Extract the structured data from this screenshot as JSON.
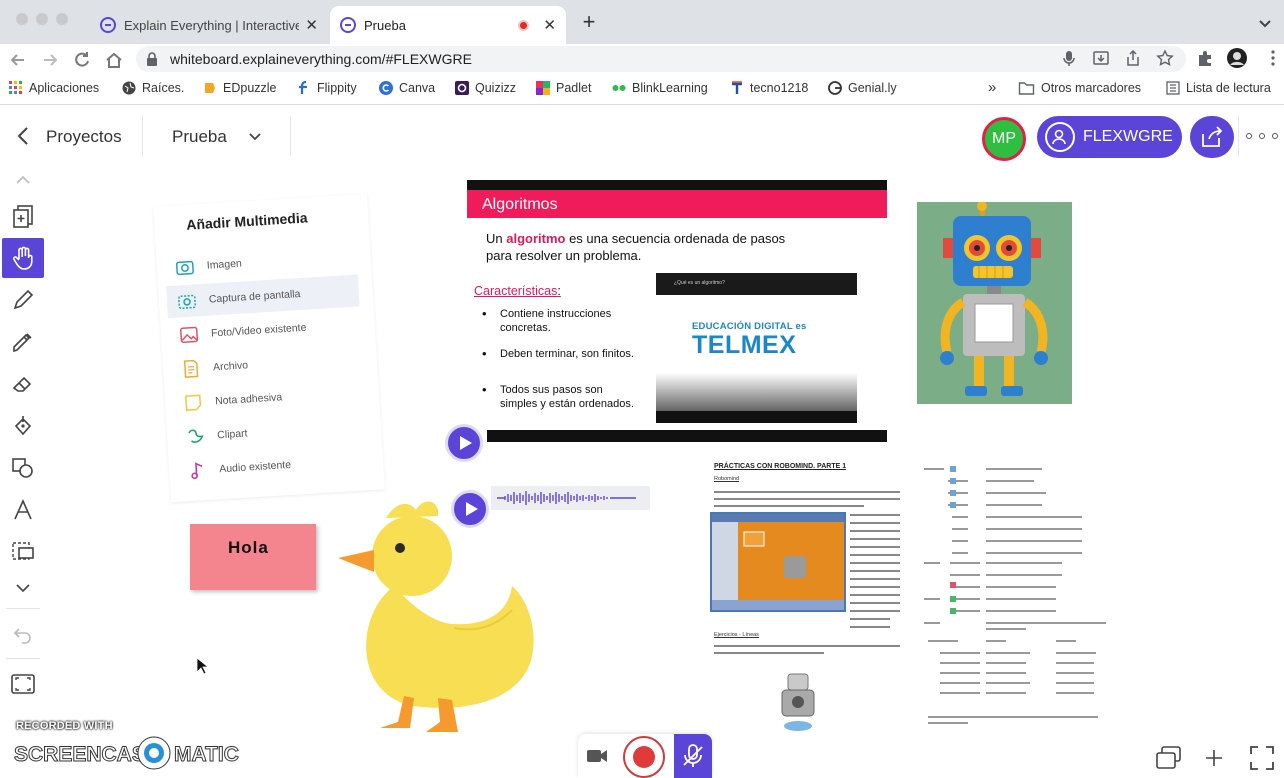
{
  "browser": {
    "tabs": [
      {
        "title": "Explain Everything | Interactive",
        "active": false
      },
      {
        "title": "Prueba",
        "active": true,
        "recording": true
      }
    ],
    "url": "whiteboard.explaineverything.com/#FLEXWGRE",
    "bookmarks": [
      "Aplicaciones",
      "Raíces.",
      "EDpuzzle",
      "Flippity",
      "Canva",
      "Quizizz",
      "Padlet",
      "BlinkLearning",
      "tecno1218",
      "Genial.ly"
    ],
    "other_bookmarks": "Otros marcadores",
    "reading_list": "Lista de lectura",
    "overflow": "»"
  },
  "header": {
    "back_label": "Proyectos",
    "project_name": "Prueba",
    "avatar_initials": "MP",
    "session_code": "FLEXWGRE"
  },
  "tools": [
    "chevron-up",
    "add-slide",
    "hand",
    "pen",
    "highlighter",
    "eraser",
    "fill",
    "shapes",
    "text",
    "select",
    "chevron-down",
    "undo",
    "fit-screen"
  ],
  "multimedia": {
    "title": "Añadir Multimedia",
    "items": [
      "Imagen",
      "Captura de pantalla",
      "Foto/Video existente",
      "Archivo",
      "Nota adhesiva",
      "Clipart",
      "Audio existente"
    ]
  },
  "sticky_note": "Hola",
  "slide": {
    "heading": "Algoritmos",
    "line1_pre": "Un ",
    "line1_bold": "algoritmo",
    "line1_post": " es una secuencia ordenada de pasos",
    "line2": "para resolver un problema.",
    "characteristics": "Características",
    "colon": ":",
    "bullets": [
      "Contiene instrucciones concretas.",
      "Deben terminar, son finitos.",
      "Todos sus pasos son simples y están ordenados."
    ]
  },
  "video": {
    "title": "¿Qué es un algoritmo?",
    "brand_top": "EDUCACIÓN DIGITAL es",
    "brand_main": "TELMEX"
  },
  "doc": {
    "title": "PRÁCTICAS CON ROBOMIND. PARTE 1",
    "subtitle": "Robomind",
    "subtitle2": "Ejercicios - Líneas"
  },
  "watermark": {
    "small": "RECORDED WITH",
    "big": "SCREENCAST",
    "big2": "MATIC"
  },
  "colors": {
    "accent": "#5b45d9",
    "slide_red": "#ef1b5a",
    "sticky": "#f4858f",
    "avatar": "#2fbe3f",
    "record": "#e03a3a"
  }
}
